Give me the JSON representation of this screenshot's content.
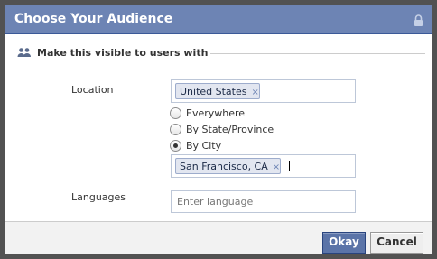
{
  "dialog": {
    "title": "Choose Your Audience",
    "title_icon": "lock-icon"
  },
  "section": {
    "icon": "users-icon",
    "heading": "Make this visible to users with"
  },
  "location": {
    "label": "Location",
    "country_token": "United States",
    "remove_glyph": "×",
    "options": [
      {
        "label": "Everywhere",
        "checked": false
      },
      {
        "label": "By State/Province",
        "checked": false
      },
      {
        "label": "By City",
        "checked": true
      }
    ],
    "city_token": "San Francisco, CA"
  },
  "languages": {
    "label": "Languages",
    "placeholder": "Enter language"
  },
  "buttons": {
    "okay": "Okay",
    "cancel": "Cancel"
  },
  "colors": {
    "titlebar": "#6d84b4",
    "primary_button": "#5b74a8"
  }
}
